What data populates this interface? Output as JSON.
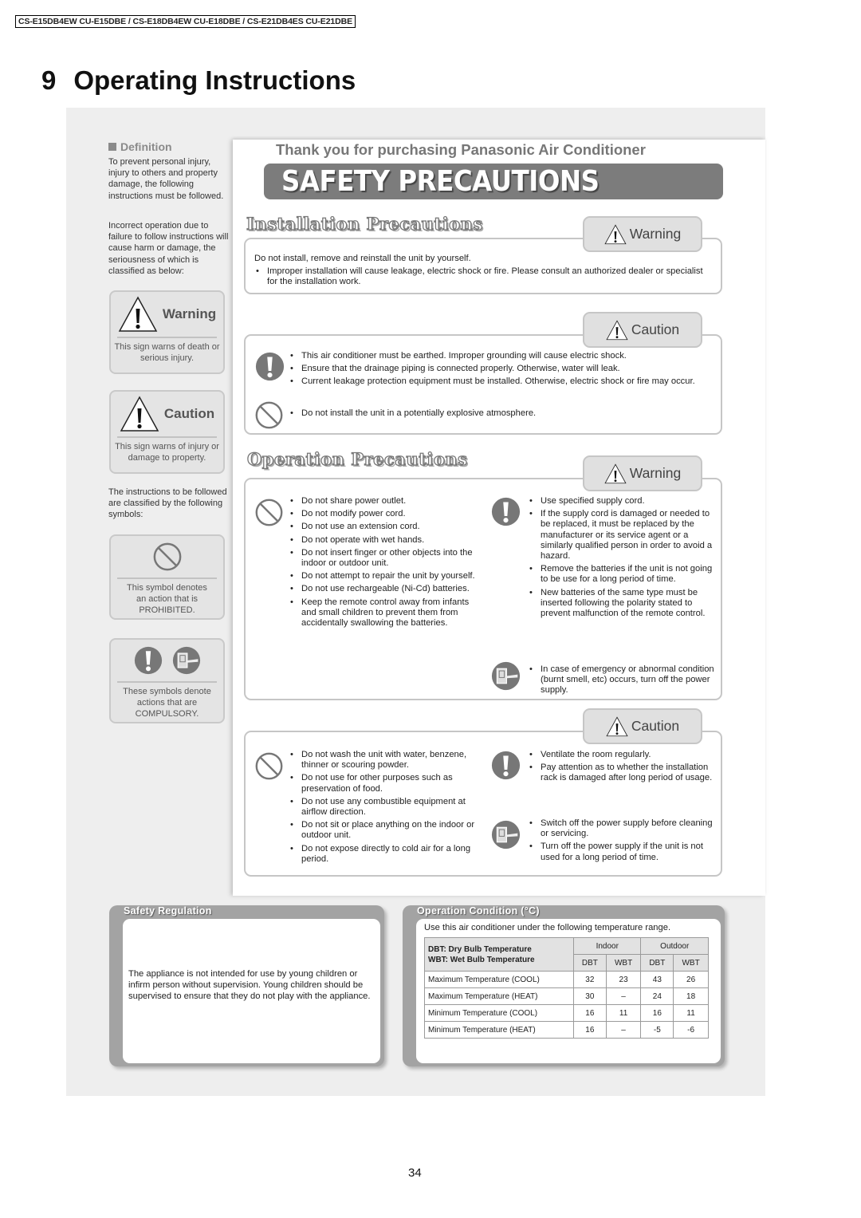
{
  "header": {
    "model_line": "CS-E15DB4EW CU-E15DBE / CS-E18DB4EW CU-E18DBE / CS-E21DB4ES CU-E21DBE",
    "section_number": "9",
    "section_title": "Operating Instructions"
  },
  "definition": {
    "heading": "Definition",
    "para1": "To prevent personal injury, injury to others and property damage, the following instructions must be followed.",
    "para2": "Incorrect operation due to failure to follow instructions will cause harm or damage, the seriousness of which is classified as below:",
    "warning": {
      "label": "Warning",
      "desc": "This sign warns of death or serious injury."
    },
    "caution": {
      "label": "Caution",
      "desc": "This sign warns of injury or damage to property."
    },
    "symbols_intro": "The instructions to be followed are classified by the following symbols:",
    "prohibited": {
      "desc_line1": "This symbol denotes",
      "desc_line2": "an action that is",
      "desc_line3": "PROHIBITED."
    },
    "compulsory": {
      "desc_line1": "These symbols denote",
      "desc_line2": "actions that are",
      "desc_line3": "COMPULSORY."
    }
  },
  "main": {
    "thanks": "Thank you for purchasing Panasonic Air Conditioner",
    "banner": "SAFETY PRECAUTIONS",
    "installation": {
      "title": "Installation Precautions",
      "warning": {
        "label": "Warning",
        "lead": "Do not install, remove and reinstall the unit by yourself.",
        "items": [
          "Improper installation will cause leakage, electric shock or fire. Please consult an authorized dealer or specialist for the installation work."
        ]
      },
      "caution": {
        "label": "Caution",
        "compulsory_items": [
          "This air conditioner must be earthed. Improper grounding will cause electric shock.",
          "Ensure that the drainage piping is connected properly. Otherwise, water will leak.",
          "Current leakage protection equipment must be installed. Otherwise, electric shock or fire may occur."
        ],
        "prohibited_items": [
          "Do not install the unit in a potentially explosive atmosphere."
        ]
      }
    },
    "operation": {
      "title": "Operation Precautions",
      "warning": {
        "label": "Warning",
        "prohibited_items": [
          "Do not share power outlet.",
          "Do not modify power cord.",
          "Do not use an extension cord.",
          "Do not operate with wet hands.",
          "Do not insert finger or other objects into the indoor or outdoor unit.",
          "Do not attempt to repair the unit by yourself.",
          "Do not use rechargeable (Ni-Cd) batteries.",
          "Keep the remote control away from infants and small children to prevent them from accidentally swallowing the batteries."
        ],
        "compulsory_items": [
          "Use specified supply cord.",
          "If the supply cord is damaged or needed to be replaced, it must be replaced by the manufacturer or its service agent or a similarly qualified person in order to avoid a hazard.",
          "Remove the batteries if the unit is not going to be use for a long period of time.",
          "New batteries of the same type must be inserted following the polarity stated to prevent malfunction of the remote control."
        ],
        "unplug_items": [
          "In case of emergency or abnormal condition (burnt smell, etc) occurs, turn off the power supply."
        ]
      },
      "caution": {
        "label": "Caution",
        "prohibited_items": [
          "Do not wash the unit with water, benzene, thinner or scouring powder.",
          "Do not use for other purposes such as preservation of food.",
          "Do not use any combustible equipment at airflow direction.",
          "Do not sit or place anything on the indoor or outdoor unit.",
          "Do not expose directly to cold air for a long period."
        ],
        "compulsory_items": [
          "Ventilate the room regularly.",
          "Pay attention as to whether the installation rack is damaged after long period of usage."
        ],
        "unplug_items": [
          "Switch off the power supply before cleaning or servicing.",
          "Turn off the power supply if the unit is not used for a long period of time."
        ]
      }
    }
  },
  "safety_regulation": {
    "title": "Safety Regulation",
    "text": "The appliance is not intended for use by young children or infirm person without supervision. Young children should be supervised to ensure that they do not play with the appliance."
  },
  "operation_condition": {
    "title": "Operation Condition (°C)",
    "intro": "Use this air conditioner under the following temperature range.",
    "legend_line1": "DBT: Dry Bulb Temperature",
    "legend_line2": "WBT: Wet Bulb Temperature",
    "group_headers": [
      "Indoor",
      "Outdoor"
    ],
    "sub_headers": [
      "DBT",
      "WBT",
      "DBT",
      "WBT"
    ],
    "rows": [
      {
        "label": "Maximum Temperature (COOL)",
        "values": [
          "32",
          "23",
          "43",
          "26"
        ]
      },
      {
        "label": "Maximum Temperature (HEAT)",
        "values": [
          "30",
          "–",
          "24",
          "18"
        ]
      },
      {
        "label": "Minimum Temperature (COOL)",
        "values": [
          "16",
          "11",
          "16",
          "11"
        ]
      },
      {
        "label": "Minimum Temperature (HEAT)",
        "values": [
          "16",
          "–",
          "-5",
          "-6"
        ]
      }
    ]
  },
  "footer": {
    "page_number": "34"
  }
}
